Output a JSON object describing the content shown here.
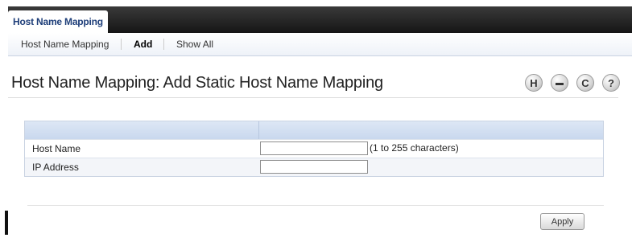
{
  "tabs": [
    {
      "label": "Host Name Mapping"
    }
  ],
  "subnav": {
    "items": [
      {
        "label": "Host Name Mapping"
      },
      {
        "label": "Add"
      },
      {
        "label": "Show All"
      }
    ],
    "active": "Add"
  },
  "page": {
    "title": "Host Name Mapping: Add Static Host Name Mapping"
  },
  "toolbar": {
    "icons": [
      {
        "name": "save-icon",
        "glyph": "H"
      },
      {
        "name": "print-icon",
        "glyph": "▬"
      },
      {
        "name": "refresh-icon",
        "glyph": "C"
      },
      {
        "name": "help-icon",
        "glyph": "?"
      }
    ]
  },
  "form": {
    "rows": [
      {
        "label": "Host Name",
        "value": "",
        "hint": "(1 to 255 characters)"
      },
      {
        "label": "IP Address",
        "value": "",
        "hint": ""
      }
    ]
  },
  "actions": {
    "apply_label": "Apply"
  },
  "colors": {
    "tab_label": "#1f3f7a",
    "tabbar_bg": "#1c1c1c",
    "form_header": "#d4e0f1"
  }
}
